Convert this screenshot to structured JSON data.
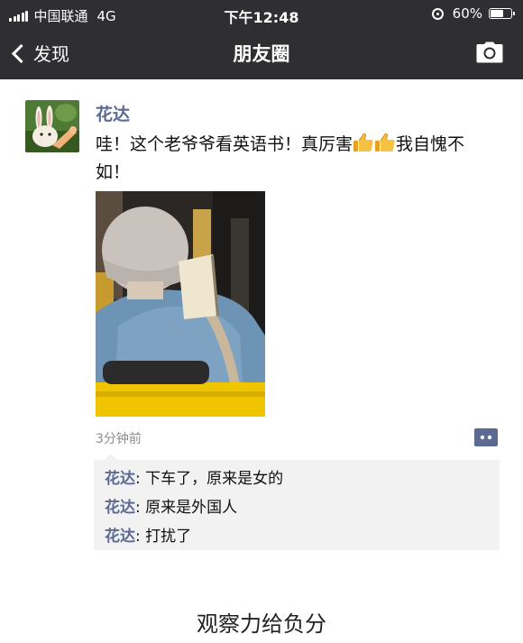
{
  "status_bar": {
    "carrier": "中国联通",
    "network": "4G",
    "time": "下午12:48",
    "battery_percent": "60%",
    "battery_level": 0.6
  },
  "nav": {
    "back_label": "发现",
    "title": "朋友圈",
    "camera_icon": "camera-icon"
  },
  "post": {
    "author": "花达",
    "text_part1": "哇！这个老爷爷看英语书！真厉害",
    "text_part2": "我自愧不如！",
    "emoji": "thumbs-up-icon",
    "time_ago": "3分钟前",
    "more_icon": "comment-more-icon"
  },
  "comments": [
    {
      "name": "花达",
      "sep": ": ",
      "text": "下车了，原来是女的"
    },
    {
      "name": "花达",
      "sep": ": ",
      "text": "原来是外国人"
    },
    {
      "name": "花达",
      "sep": ": ",
      "text": "打扰了"
    }
  ],
  "caption": "观察力给负分",
  "colors": {
    "nav_bg": "#2f2f31",
    "name_blue": "#5b6a92",
    "comment_bg": "#f2f2f3"
  }
}
